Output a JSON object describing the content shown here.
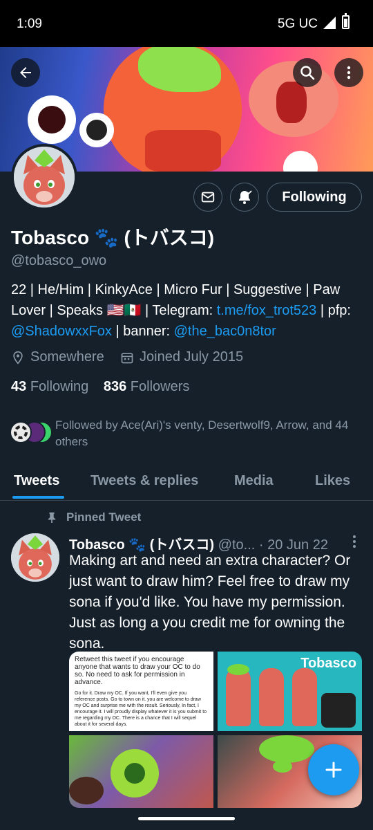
{
  "status_bar": {
    "time": "1:09",
    "network": "5G UC"
  },
  "profile": {
    "display_name": "Tobasco 🐾 (トバスコ)",
    "handle": "@tobasco_owo",
    "bio": {
      "text_1": "22 | He/Him | KinkyAce | Micro Fur | Suggestive | Paw Lover | Speaks 🇺🇸🇲🇽 | Telegram: ",
      "telegram_link": "t.me/fox_trot523",
      "text_2": " | pfp: ",
      "pfp_link": "@ShadowxxFox",
      "text_3": " | banner: ",
      "banner_link": "@the_bac0n8tor"
    },
    "location": "Somewhere",
    "joined": "Joined July 2015",
    "following_count": "43",
    "following_label": "Following",
    "followers_count": "836",
    "followers_label": "Followers",
    "followed_by": "Followed by Ace(Ari)'s venty, Desertwolf9, Arrow, and 44 others",
    "following_button": "Following"
  },
  "tabs": [
    "Tweets",
    "Tweets & replies",
    "Media",
    "Likes"
  ],
  "pinned_tweet": {
    "label": "Pinned Tweet",
    "author": "Tobasco 🐾 (トバスコ)",
    "handle": "@to...",
    "date": "· 20 Jun 22",
    "text": "Making art and need an extra character? Or just want to draw him? Feel free to draw my sona if you'd like. You have my permission. Just as long a you credit me for owning the sona.",
    "media_1_text": "Retweet this tweet if you encourage anyone that wants to draw your OC to do so. No need to ask for permission in advance.",
    "media_1_body": "Go for it. Draw my OC. If you want, I'll even give you reference posts. Go to town on it. you are welcome to draw my OC and surprise me with the result. Seriously, In fact, I encourage it. I will proudly display whatever it is you submit to me regarding my OC. There is a chance that I will sequel about it for several days.",
    "media_2_title": "Tobasco"
  },
  "colors": {
    "background": "#15202b",
    "accent": "#1d9bf0",
    "muted": "#8b98a5",
    "border": "#38444d"
  },
  "icons": [
    "back-arrow-icon",
    "search-icon",
    "more-vertical-icon",
    "mail-icon",
    "bell-icon",
    "location-pin-icon",
    "calendar-icon",
    "pin-icon",
    "plus-icon"
  ]
}
